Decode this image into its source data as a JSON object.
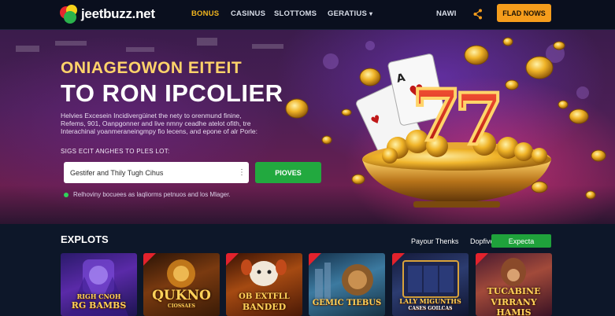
{
  "header": {
    "logo_text": "jeetbuzz.net",
    "nav": [
      {
        "label": "BONUS",
        "active": true
      },
      {
        "label": "CASINUS"
      },
      {
        "label": "SLOTTOMS"
      },
      {
        "label": "GERATIUS"
      }
    ],
    "nav_right": "NAWI",
    "share_icon": "share-icon",
    "cta_label": "FLAD NOWS"
  },
  "hero": {
    "title_line1": "ONIAGEOWON EITEIT",
    "title_line2": "TO RON IPCOLIER",
    "description_lines": [
      "Helvies Excesein Incidivergüinet the nety to orenmund finine,",
      "Refems, 901, Oanpgonner and live nmny ceadhe atelot ofith, tre",
      "Interachinal yoanmeraneingmpy fio lecens, and epone of alr Porle:"
    ],
    "search_label": "SIGS ECIT ANGHES TO PLES LOT:",
    "search_value": "Gestifer and Thily Tugh Cihus",
    "search_button": "PIOVES",
    "note": "Relhoviny bocuees as laqliorms petnuos and los Mlager."
  },
  "section": {
    "title": "EXPLOTS",
    "link1": "Payour Thenks",
    "link2": "Dopfive",
    "button": "Expecta",
    "games": [
      {
        "title_line1": "RIGH CNOH",
        "title_line2": "RG BAMBS"
      },
      {
        "title_line1": "QUKNO",
        "title_line2": "CIOSSAES"
      },
      {
        "title_line1": "OB EXTFLL",
        "title_line2": "BANDED"
      },
      {
        "title_line1": "GEMIC TIEBUS",
        "title_line2": ""
      },
      {
        "title_line1": "LALY MIGUNTHS",
        "title_line2": "CASES GOILCAS"
      },
      {
        "title_line1": "TUCABINE",
        "title_line2": "VIRRANY HAMIS"
      }
    ]
  },
  "colors": {
    "accent_gold": "#f2b51e",
    "cta_orange": "#f59d1c",
    "action_green": "#22a93f",
    "header_bg": "#0a0f1e"
  }
}
